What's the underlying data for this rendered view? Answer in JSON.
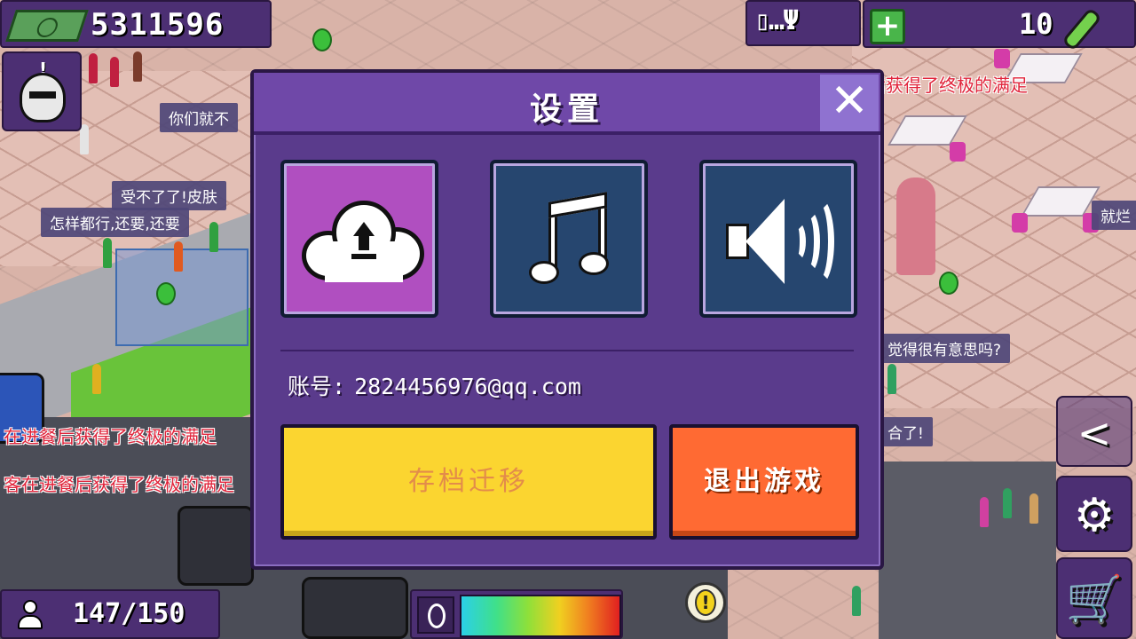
{
  "hud": {
    "money": "5311596",
    "status_icons": "▯…Ψ",
    "gems": "10",
    "population": "147/150"
  },
  "world_messages": {
    "top_right": "有一位顾客在进餐后获得了终极的满足",
    "left_1": "在进餐后获得了终极的满足",
    "left_2": "客在进餐后获得了终极的满足"
  },
  "speech_bubbles": [
    "你们就不",
    "受不了了!皮肤",
    "怎样都行,还要,还要",
    "觉得很有意思吗?",
    "合了!",
    "就烂"
  ],
  "dialog": {
    "title": "设置",
    "close_label": "✕",
    "account_label": "账号:",
    "account_value": "2824456976@qq.com",
    "migrate_label": "存档迁移",
    "exit_label": "退出游戏"
  },
  "icons": {
    "money": "cash-stack-icon",
    "plus": "+",
    "settings": "⚙",
    "shop": "🛒",
    "share": "share-icon",
    "alert": "!"
  },
  "colors": {
    "dialog_bg": "#5a3b8c",
    "cloud_option": "#b04fc0",
    "option_bg": "#26466f",
    "migrate_button": "#fbd530",
    "exit_button": "#ff6a33"
  }
}
